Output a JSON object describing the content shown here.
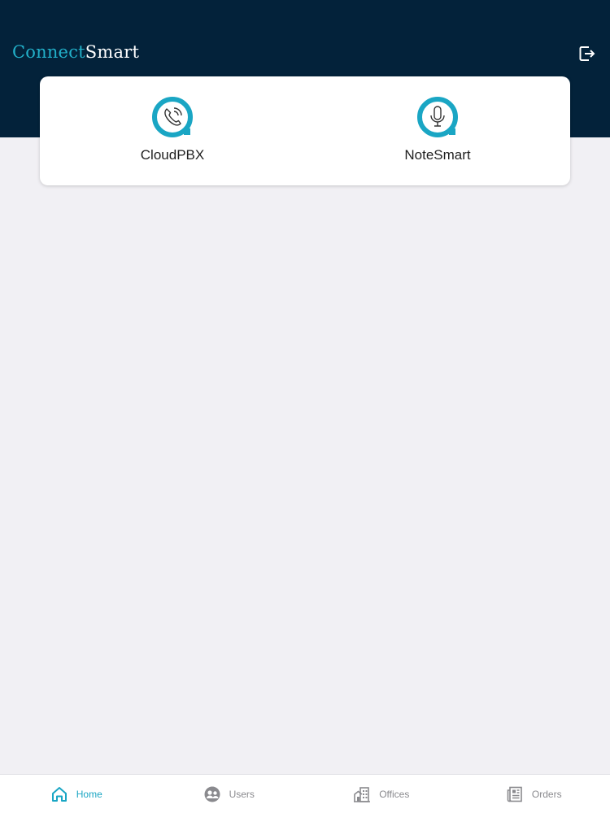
{
  "header": {
    "logo_part1": "Connect",
    "logo_part2": "Smart",
    "logout_icon": "logout-icon"
  },
  "apps": [
    {
      "label": "CloudPBX",
      "icon": "phone-icon"
    },
    {
      "label": "NoteSmart",
      "icon": "microphone-icon"
    }
  ],
  "tabbar": {
    "items": [
      {
        "label": "Home",
        "icon": "home-icon",
        "active": true
      },
      {
        "label": "Users",
        "icon": "users-icon",
        "active": false
      },
      {
        "label": "Offices",
        "icon": "building-icon",
        "active": false
      },
      {
        "label": "Orders",
        "icon": "orders-icon",
        "active": false
      }
    ]
  },
  "colors": {
    "header_bg": "#03223a",
    "accent": "#1aa6c4",
    "page_bg": "#f1f0f4"
  }
}
